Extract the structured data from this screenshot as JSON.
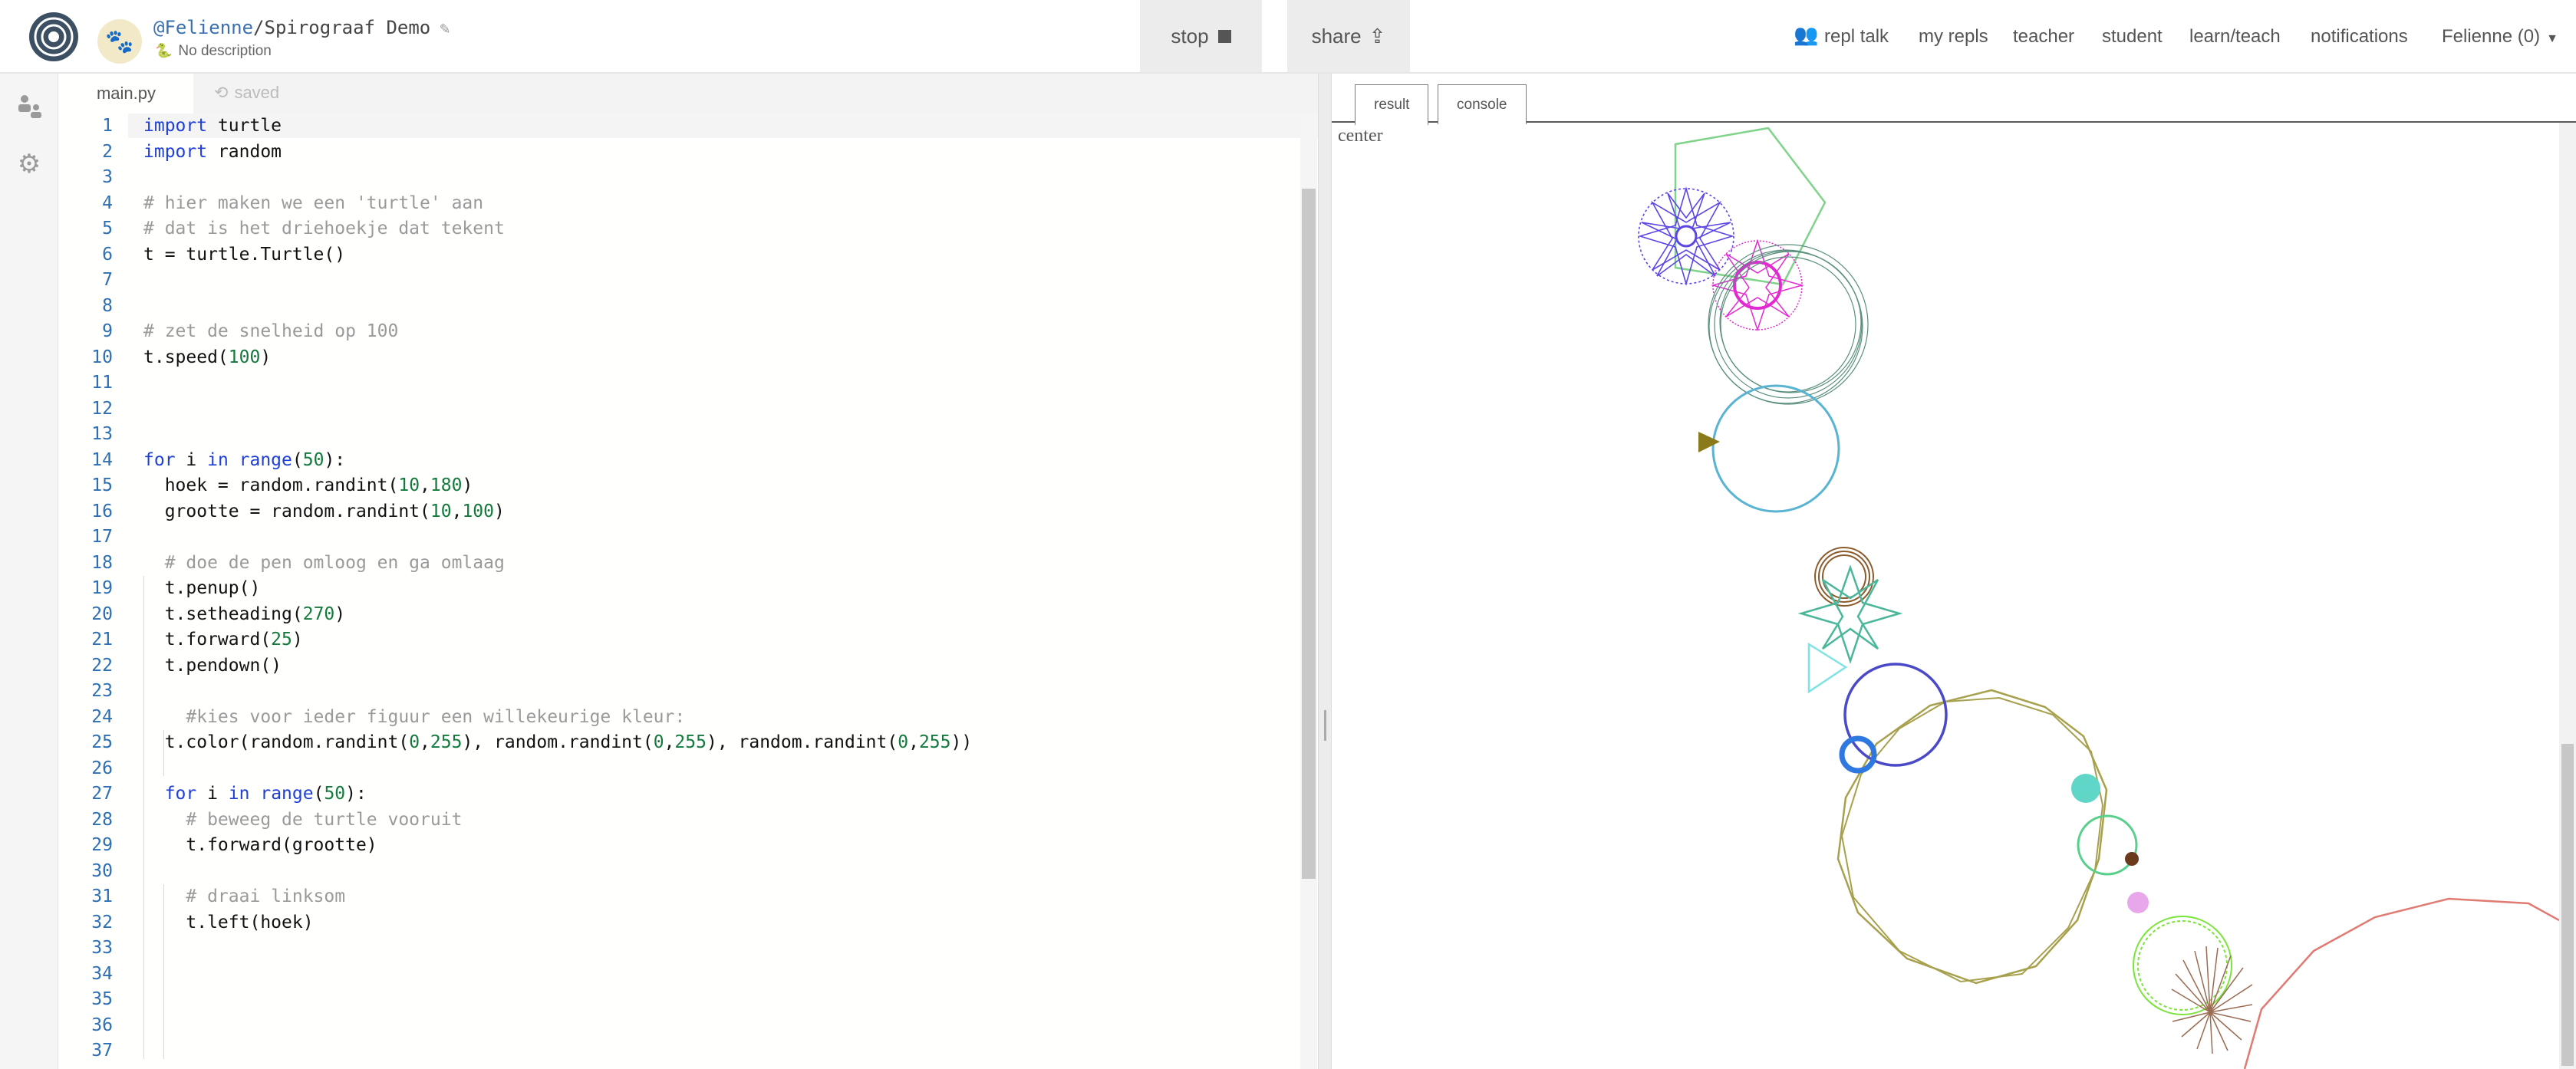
{
  "header": {
    "repl_owner": "@Felienne",
    "repl_sep": "/",
    "repl_name": "Spirograaf Demo",
    "description": "No description",
    "stop_label": "stop",
    "share_label": "share",
    "nav": {
      "repl_talk": "repl talk",
      "my_repls": "my repls",
      "teacher": "teacher",
      "student": "student",
      "learn_teach": "learn/teach",
      "notifications": "notifications"
    },
    "user_menu": "Felienne (0)"
  },
  "editor": {
    "file_tab": "main.py",
    "saved_status": "saved",
    "line_numbers": [
      "1",
      "2",
      "3",
      "4",
      "5",
      "6",
      "7",
      "8",
      "9",
      "10",
      "11",
      "12",
      "13",
      "14",
      "15",
      "16",
      "17",
      "18",
      "19",
      "20",
      "21",
      "22",
      "23",
      "24",
      "25",
      "26",
      "27",
      "28",
      "29",
      "30",
      "31",
      "32",
      "33",
      "34",
      "35",
      "36",
      "37"
    ],
    "lines": {
      "l1_kw": "import",
      "l1_rest": " turtle",
      "l2_kw": "import",
      "l2_rest": " random",
      "l4": "# hier maken we een 'turtle' aan",
      "l5": "# dat is het driehoekje dat tekent",
      "l6": "t = turtle.Turtle()",
      "l9": "# zet de snelheid op 100",
      "l10_a": "t.speed(",
      "l10_n": "100",
      "l10_b": ")",
      "l14_for": "for",
      "l14_a": " i ",
      "l14_in": "in",
      "l14_range": " range",
      "l14_b": "(",
      "l14_n": "50",
      "l14_c": "):",
      "l15_a": "  hoek = random.randint(",
      "l15_n1": "10",
      "l15_c": ",",
      "l15_n2": "180",
      "l15_b": ")",
      "l16_a": "  grootte = random.randint(",
      "l16_n1": "10",
      "l16_c": ",",
      "l16_n2": "100",
      "l16_b": ")",
      "l18": "  # doe de pen omloog en ga omlaag",
      "l19": "  t.penup()",
      "l20_a": "  t.setheading(",
      "l20_n": "270",
      "l20_b": ")",
      "l21_a": "  t.forward(",
      "l21_n": "25",
      "l21_b": ")",
      "l22": "  t.pendown()",
      "l24": "    #kies voor ieder figuur een willekeurige kleur:",
      "l25_a": "  t.color(random.randint(",
      "l25_n1": "0",
      "l25_c1": ",",
      "l25_n2": "255",
      "l25_d": "), random.randint(",
      "l25_n3": "0",
      "l25_c2": ",",
      "l25_n4": "255",
      "l25_e": "), random.randint(",
      "l25_n5": "0",
      "l25_c3": ",",
      "l25_n6": "255",
      "l25_f": "))",
      "l27_for": "  for",
      "l27_a": " i ",
      "l27_in": "in",
      "l27_range": " range",
      "l27_b": "(",
      "l27_n": "50",
      "l27_c": "):",
      "l28": "    # beweeg de turtle vooruit",
      "l29": "    t.forward(grootte)",
      "l31": "    # draai linksom",
      "l32": "    t.left(hoek)"
    }
  },
  "output": {
    "tab_result": "result",
    "tab_console": "console",
    "canvas_label": "center"
  },
  "colors": {
    "keyword": "#1f3fd6",
    "number": "#137a3c",
    "comment": "#9a9a9a",
    "line_number": "#2d6fb3"
  }
}
